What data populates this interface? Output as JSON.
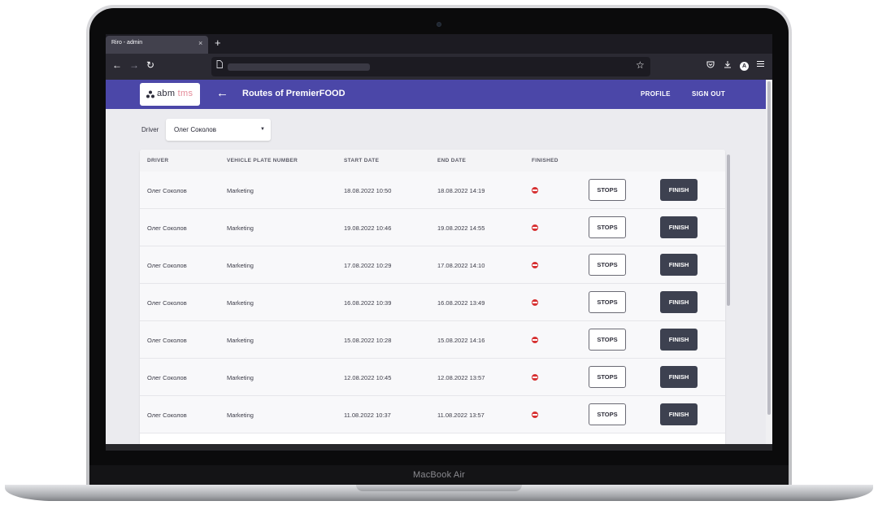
{
  "device": {
    "label": "MacBook Air"
  },
  "browser": {
    "tab_title": "Riro - admin",
    "tab_close": "×",
    "new_tab": "+",
    "icons": [
      "back-icon",
      "forward-icon",
      "reload-icon",
      "page-icon",
      "star-icon",
      "pocket-icon",
      "download-icon",
      "account-icon",
      "menu-icon"
    ],
    "account_initial": "A"
  },
  "header": {
    "logo_abm": "abm",
    "logo_tms": "tms",
    "back_icon": "←",
    "title": "Routes of PremierFOOD",
    "profile": "PROFILE",
    "sign_out": "SIGN OUT",
    "color": "#4b47a8"
  },
  "filter": {
    "label": "Driver",
    "value": "Олег Соколов"
  },
  "table": {
    "columns": [
      "DRIVER",
      "VEHICLE PLATE NUMBER",
      "START DATE",
      "END DATE",
      "FINISHED"
    ],
    "stops_label": "STOPS",
    "finish_label": "FINISH",
    "finished_icon": "no-entry-icon",
    "rows": [
      {
        "driver": "Олег Соколов",
        "plate": "Marketing",
        "start": "18.08.2022 10:50",
        "end": "18.08.2022 14:19"
      },
      {
        "driver": "Олег Соколов",
        "plate": "Marketing",
        "start": "19.08.2022 10:46",
        "end": "19.08.2022 14:55"
      },
      {
        "driver": "Олег Соколов",
        "plate": "Marketing",
        "start": "17.08.2022 10:29",
        "end": "17.08.2022 14:10"
      },
      {
        "driver": "Олег Соколов",
        "plate": "Marketing",
        "start": "16.08.2022 10:39",
        "end": "16.08.2022 13:49"
      },
      {
        "driver": "Олег Соколов",
        "plate": "Marketing",
        "start": "15.08.2022 10:28",
        "end": "15.08.2022 14:16"
      },
      {
        "driver": "Олег Соколов",
        "plate": "Marketing",
        "start": "12.08.2022 10:45",
        "end": "12.08.2022 13:57"
      },
      {
        "driver": "Олег Соколов",
        "plate": "Marketing",
        "start": "11.08.2022 10:37",
        "end": "11.08.2022 13:57"
      }
    ]
  }
}
